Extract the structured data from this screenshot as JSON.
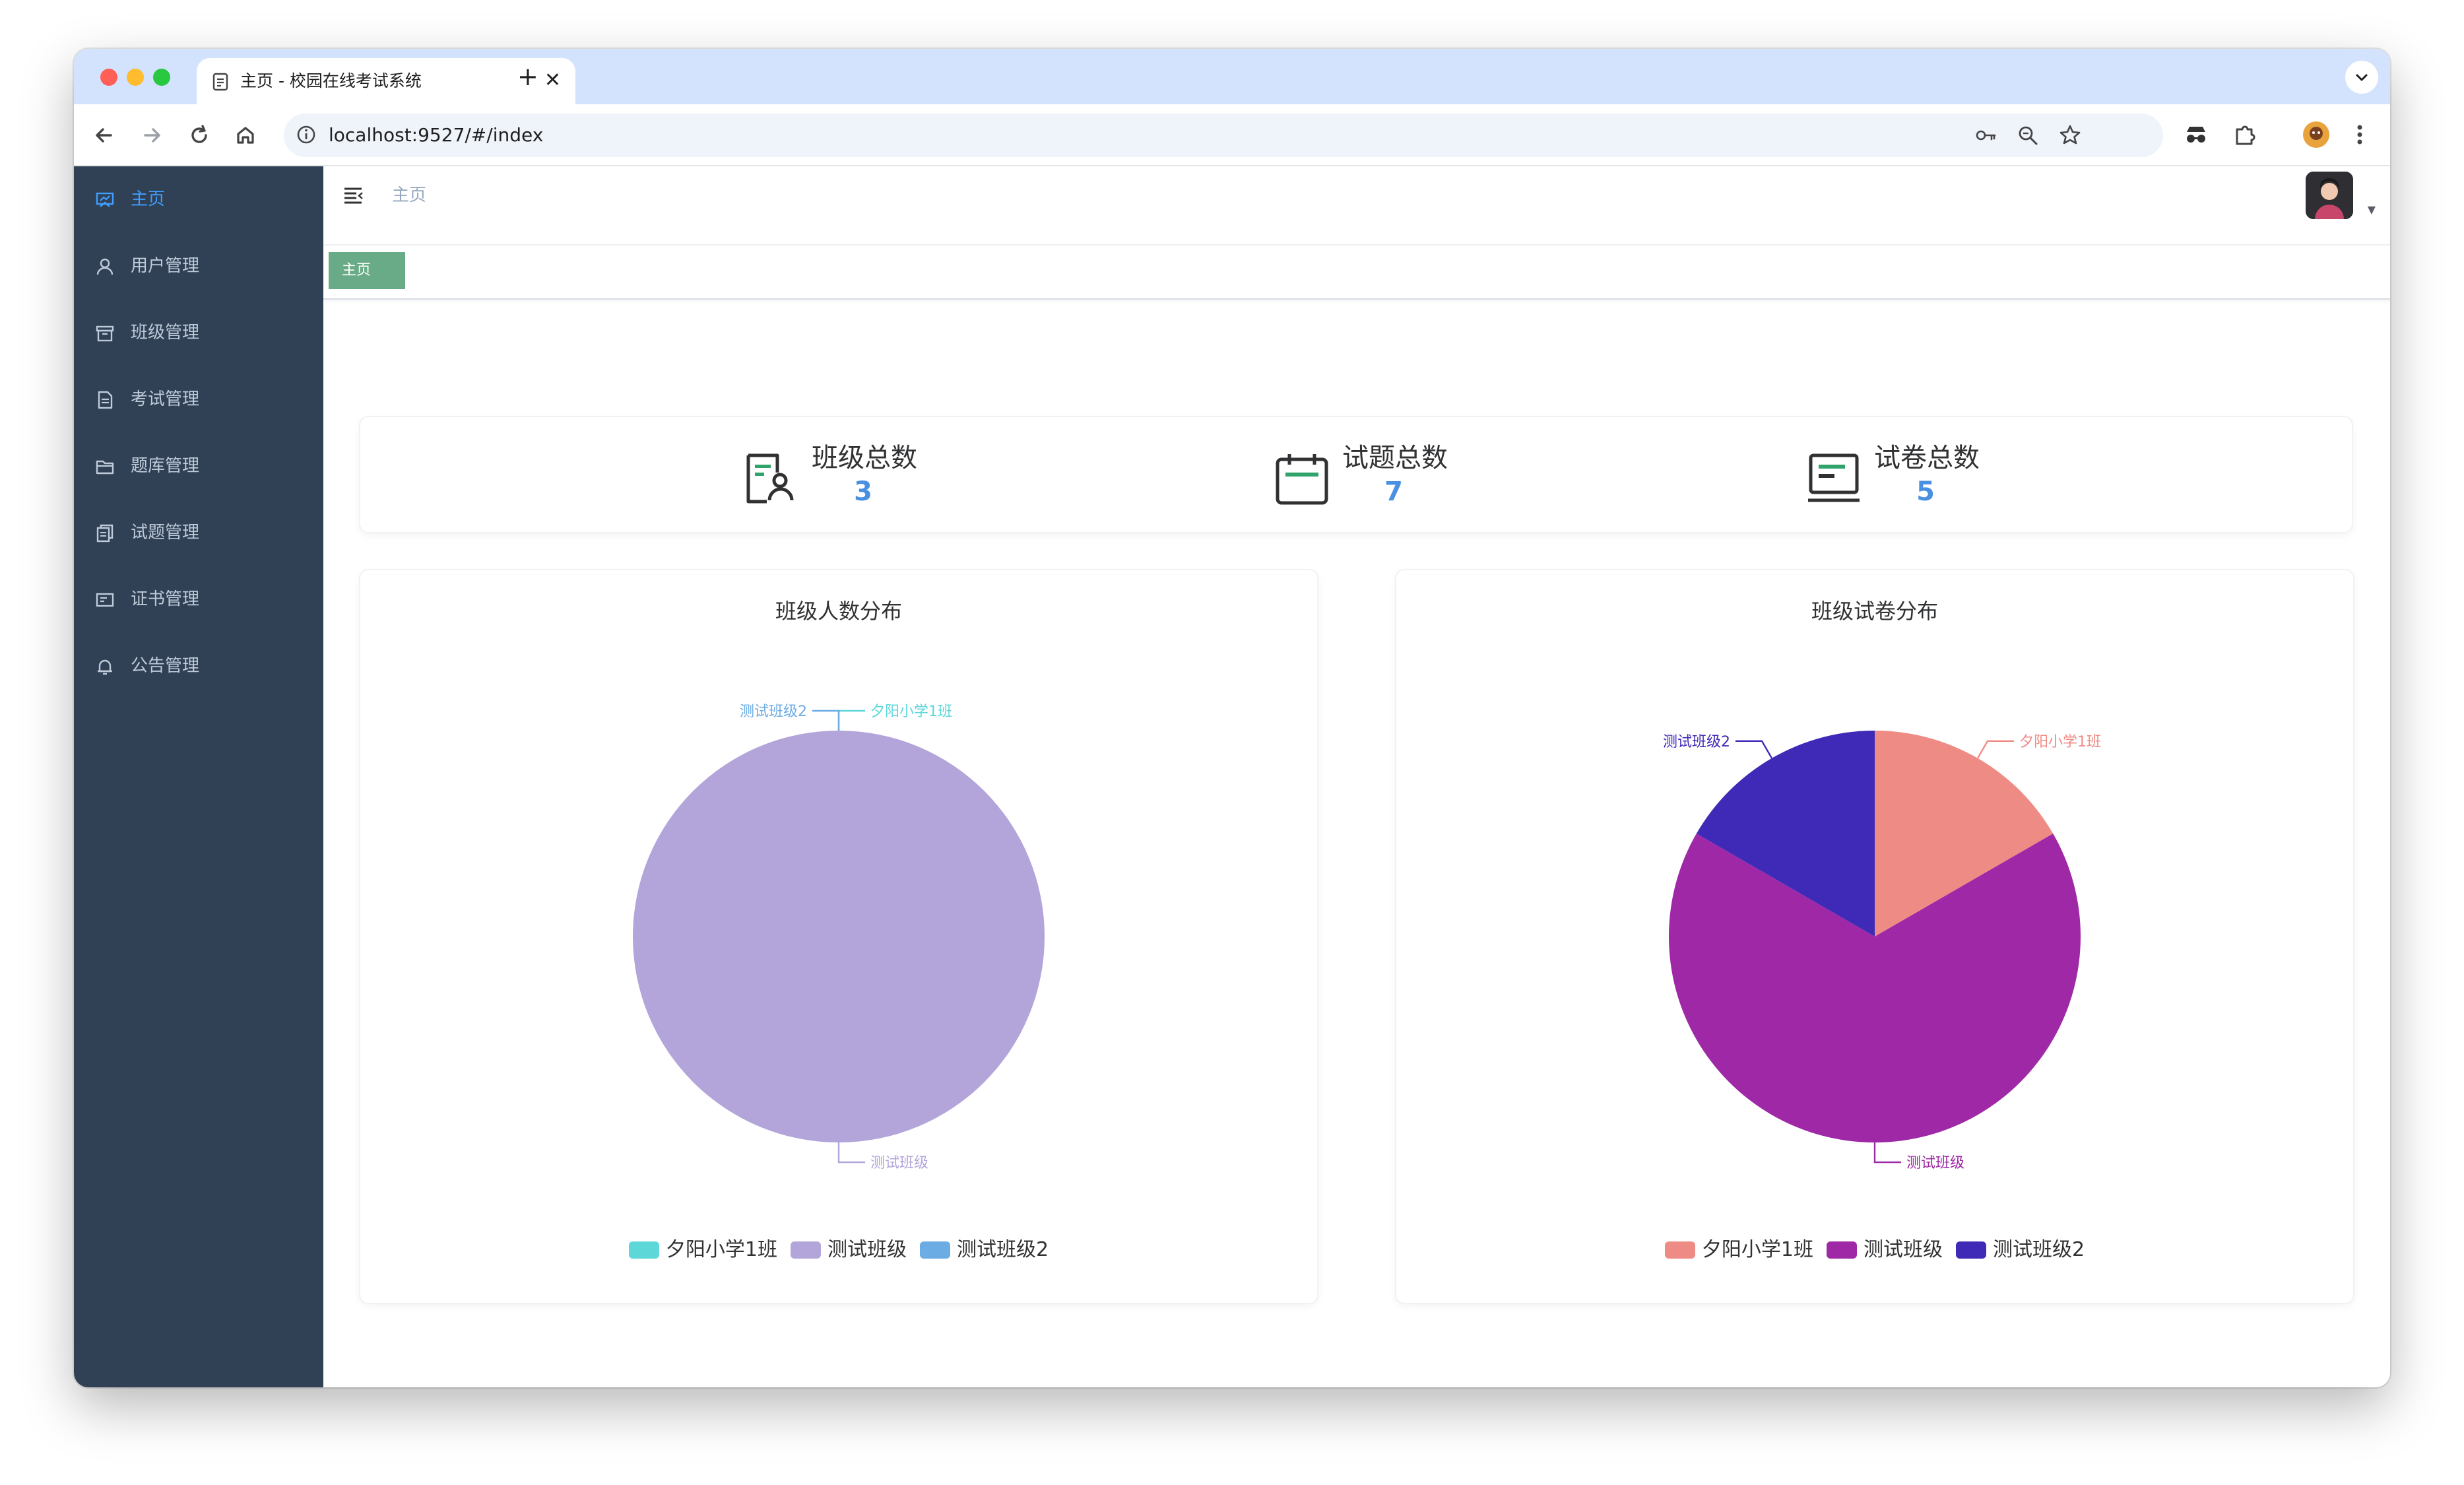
{
  "browser": {
    "tab_title": "主页 - 校园在线考试系统",
    "tab_close": "✕",
    "new_tab": "+",
    "url": "localhost:9527/#/index"
  },
  "sidebar": {
    "items": [
      {
        "label": "主页",
        "icon": "home-icon",
        "active": true
      },
      {
        "label": "用户管理",
        "icon": "user-icon"
      },
      {
        "label": "班级管理",
        "icon": "archive-icon"
      },
      {
        "label": "考试管理",
        "icon": "document-icon"
      },
      {
        "label": "题库管理",
        "icon": "folder-icon"
      },
      {
        "label": "试题管理",
        "icon": "copy-icon"
      },
      {
        "label": "证书管理",
        "icon": "certificate-icon"
      },
      {
        "label": "公告管理",
        "icon": "bell-icon"
      }
    ]
  },
  "navbar": {
    "breadcrumb": "主页"
  },
  "tags": {
    "active_tag": "主页"
  },
  "stats": [
    {
      "label": "班级总数",
      "value": "3",
      "icon": "class-icon"
    },
    {
      "label": "试题总数",
      "value": "7",
      "icon": "calendar-icon"
    },
    {
      "label": "试卷总数",
      "value": "5",
      "icon": "laptop-icon"
    }
  ],
  "colors": {
    "sidebar_bg": "#304156",
    "active_menu": "#409eff",
    "tag_active": "#6aab87",
    "stat_value": "#4a90e2"
  },
  "chart_data": [
    {
      "type": "pie",
      "title": "班级人数分布",
      "categories": [
        "夕阳小学1班",
        "测试班级",
        "测试班级2"
      ],
      "values": [
        0,
        1,
        0
      ],
      "colors": [
        "#5ed7d9",
        "#b3a5da",
        "#6cace4"
      ],
      "legend": "bottom"
    },
    {
      "type": "pie",
      "title": "班级试卷分布",
      "categories": [
        "夕阳小学1班",
        "测试班级",
        "测试班级2"
      ],
      "values": [
        1,
        4,
        1
      ],
      "colors": [
        "#ef8b85",
        "#9e28a6",
        "#3f2ab7"
      ],
      "legend": "bottom"
    }
  ]
}
